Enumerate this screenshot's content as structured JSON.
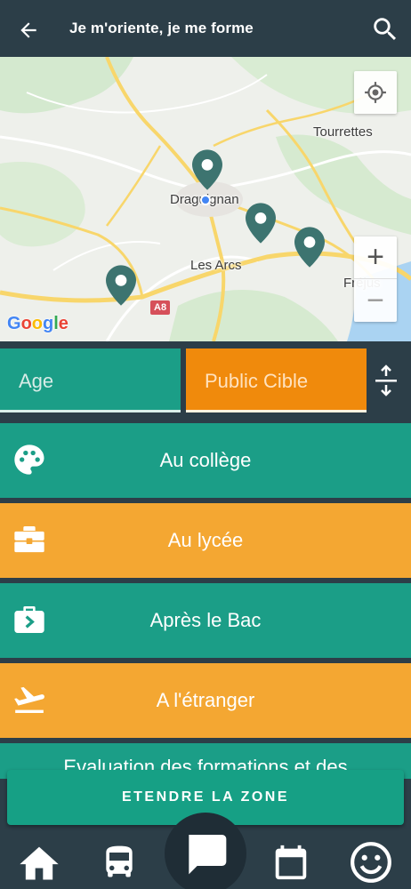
{
  "header": {
    "title": "Je m'oriente, je me forme",
    "back_icon": "arrow-left-icon",
    "search_icon": "search-icon"
  },
  "map": {
    "labels": {
      "tourrettes": "Tourrettes",
      "draguignan": "Draguignan",
      "les_arcs": "Les Arcs",
      "frejus": "Fréjus"
    },
    "road_badge": "A8",
    "google_logo": "Google",
    "zoom_in": "+",
    "zoom_out": "−",
    "pin_color": "#3d7470",
    "user_dot_color": "#4285f4"
  },
  "filters": {
    "age": "Age",
    "public_cible": "Public Cible",
    "sort_icon": "expand-collapse-icon"
  },
  "list": [
    {
      "label": "Au collège",
      "icon": "palette-icon",
      "color": "#1b9e87"
    },
    {
      "label": "Au lycée",
      "icon": "toolbox-icon",
      "color": "#f4a732"
    },
    {
      "label": "Après le Bac",
      "icon": "briefcase-arrow-icon",
      "color": "#1b9e87"
    },
    {
      "label": "A l'étranger",
      "icon": "airplane-takeoff-icon",
      "color": "#f4a732"
    },
    {
      "label": "Evaluation des formations et des",
      "icon": "",
      "color": "#1b9e87"
    }
  ],
  "extend_button": "ETENDRE LA ZONE",
  "bottom_nav": [
    "home-icon",
    "bus-icon",
    "chat-icon",
    "calendar-icon",
    "smiley-icon"
  ],
  "colors": {
    "header_bg": "#2c3e48",
    "green": "#1b9e87",
    "orange": "#f4a732",
    "public_orange": "#f08a0c"
  }
}
